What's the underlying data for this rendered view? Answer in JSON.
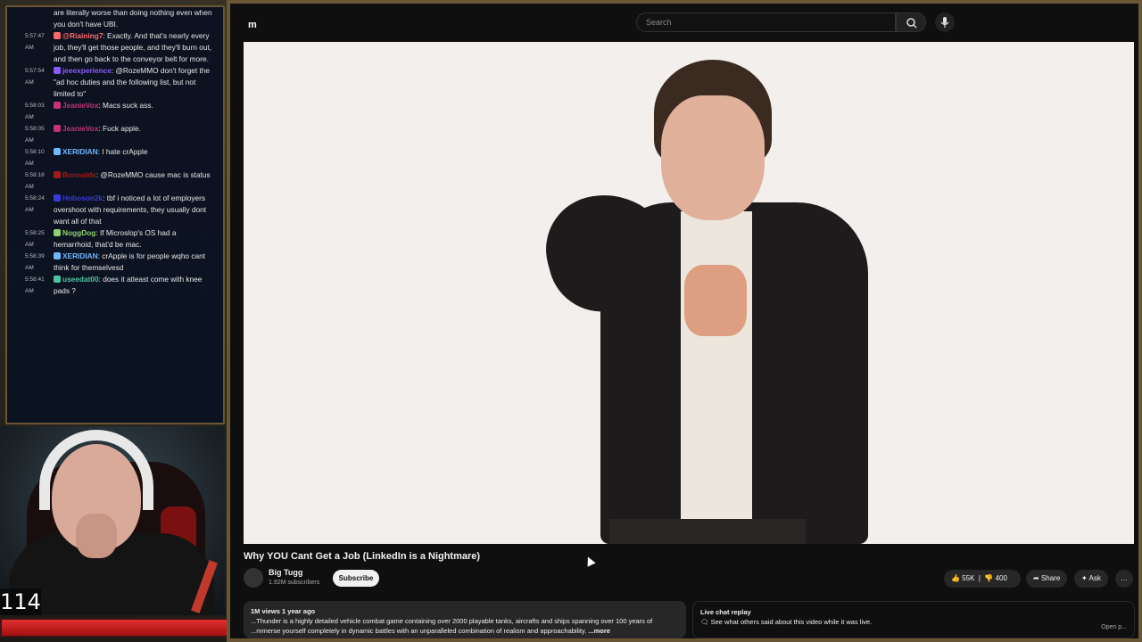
{
  "chat": {
    "messages": [
      {
        "time": "",
        "user": "",
        "user_color": "#e8e8e8",
        "text": "are literally worse than doing nothing even when you don't have UBI."
      },
      {
        "time": "5:57:47 AM",
        "user": "@Riaining7",
        "user_color": "#ff6b6b",
        "text": ": Exactly. And that's nearly every job, they'll get those people, and they'll burn out, and then go back to the conveyor belt for more."
      },
      {
        "time": "5:57:54 AM",
        "user": "jeeexperience",
        "user_color": "#8a5cf6",
        "text": ": @RozeMMO don't forget the \"ad hoc duties and the following list, but not limited to\""
      },
      {
        "time": "5:58:03 AM",
        "user": "JeanieVox",
        "user_color": "#c7327a",
        "text": ": Macs suck ass."
      },
      {
        "time": "5:58:05 AM",
        "user": "JeanieVox",
        "user_color": "#c7327a",
        "text": ": Fuck apple."
      },
      {
        "time": "5:58:10 AM",
        "user": "XERIDIAN",
        "user_color": "#6fb7ff",
        "text": ": I hate crApple"
      },
      {
        "time": "5:58:18 AM",
        "user": "Bonnalds",
        "user_color": "#a11b1b",
        "text": ": @RozeMMO cause mac is status"
      },
      {
        "time": "5:58:24 AM",
        "user": "Hoboson2k",
        "user_color": "#3a3ad6",
        "text": ": tbf i noticed a lot of employers overshoot with requirements, they usually dont want all of that"
      },
      {
        "time": "5:58:25 AM",
        "user": "NoggDog",
        "user_color": "#8fd16f",
        "text": ": If Microslop's OS had a hemarrhoid, that'd be mac."
      },
      {
        "time": "5:58:39 AM",
        "user": "XERIDIAN",
        "user_color": "#6fb7ff",
        "text": ": crApple is for people wqho cant think for themselvesd"
      },
      {
        "time": "5:58:41 AM",
        "user": "useedat00",
        "user_color": "#4fc3a1",
        "text": ": does it atleast come with knee pads ?"
      }
    ]
  },
  "overlay": {
    "counter": "114",
    "hp_fraction": 1.0
  },
  "youtube": {
    "logo_fragment": "m",
    "search_placeholder": "Search",
    "video_title": "Why YOU Cant Get a Job (LinkedIn is a Nightmare)",
    "channel_name": "Big Tugg",
    "channel_subs": "1.92M subscribers",
    "subscribe_label": "Subscribe",
    "likes": "55K",
    "dislikes": "400",
    "share_label": "Share",
    "ask_label": "Ask",
    "more_label": "…",
    "views_meta": "1M views  1 year ago",
    "description": "...Thunder is a highly detailed vehicle combat game containing over 2000 playable tanks, aircrafts and ships spanning over 100 years of ...mmerse yourself completely in dynamic battles with an unparalleled combination of realism and approachability.",
    "desc_more": "...more",
    "live_title": "Live chat replay",
    "live_text": "See what others said about this video while it was live.",
    "live_open": "Open p..."
  },
  "colors": {
    "frame_border": "#6a5634",
    "hp_red": "#d32020"
  }
}
